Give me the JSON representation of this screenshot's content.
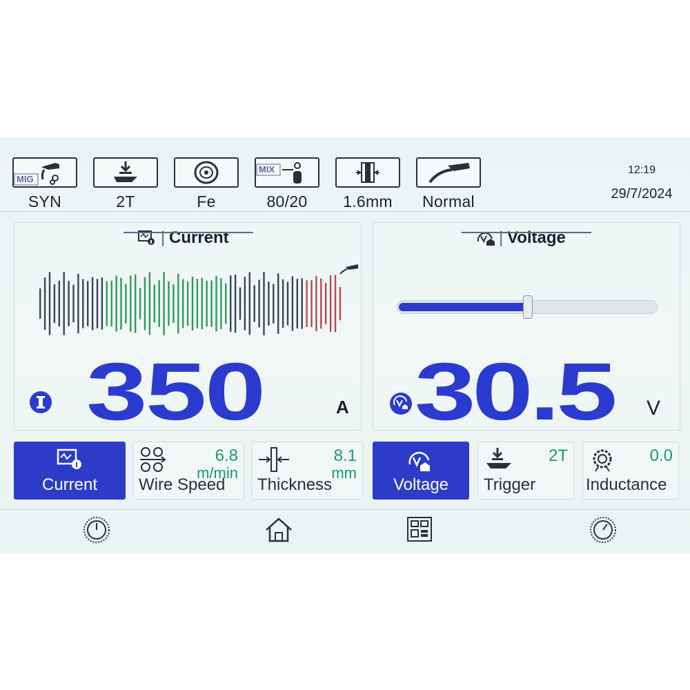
{
  "status_bar": {
    "modes": [
      {
        "label": "SYN",
        "icon": "mig-torch-icon",
        "badge": "MIG"
      },
      {
        "label": "2T",
        "icon": "trigger-icon"
      },
      {
        "label": "Fe",
        "icon": "wire-spool-icon"
      },
      {
        "label": "80/20",
        "icon": "gas-cylinder-icon",
        "badge": "MIX"
      },
      {
        "label": "1.6mm",
        "icon": "wire-diameter-icon"
      },
      {
        "label": "Normal",
        "icon": "welding-torch-icon"
      }
    ],
    "time": "12:19",
    "date": "29/7/2024"
  },
  "current_panel": {
    "title": "Current",
    "value": "350",
    "unit": "A",
    "colors": {
      "primary": "#2b3bd0",
      "wave_dark": "#3a4555",
      "wave_green": "#2f9a5a",
      "wave_red": "#b84a55"
    }
  },
  "voltage_panel": {
    "title": "Voltage",
    "value": "30.5",
    "unit": "V",
    "slider_level": 0.5
  },
  "params": [
    {
      "name": "Current",
      "active": true,
      "icon": "current-monitor-icon"
    },
    {
      "name": "Wire Speed",
      "value": "6.8",
      "unit": "m/min",
      "icon": "wire-feed-rollers-icon"
    },
    {
      "name": "Thickness",
      "value": "8.1",
      "unit": "mm",
      "icon": "thickness-icon"
    },
    {
      "name": "Voltage",
      "active": true,
      "icon": "voltage-gauge-icon"
    },
    {
      "name": "Trigger",
      "value": "2T",
      "icon": "trigger-icon"
    },
    {
      "name": "Inductance",
      "value": "0.0",
      "icon": "inductance-coil-icon"
    }
  ],
  "nav": [
    {
      "icon": "left-knob-icon"
    },
    {
      "icon": "home-icon"
    },
    {
      "icon": "menu-grid-icon"
    },
    {
      "icon": "right-knob-icon"
    }
  ]
}
